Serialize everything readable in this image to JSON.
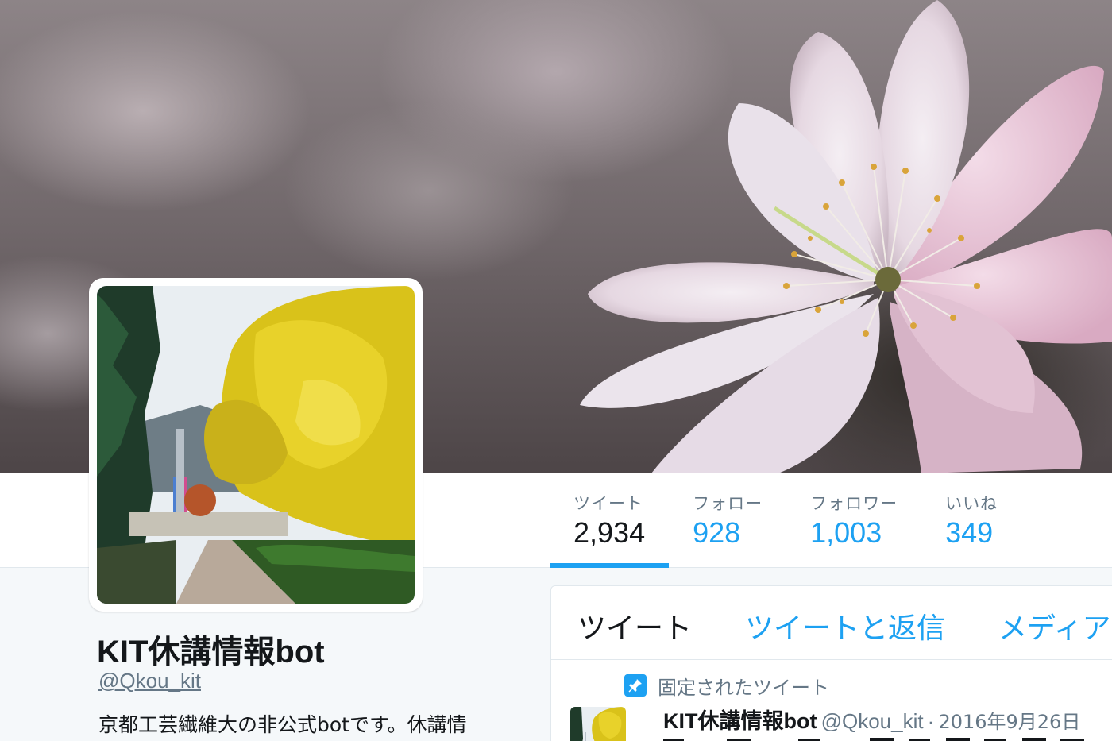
{
  "profile": {
    "name": "KIT休講情報bot",
    "handle": "@Qkou_kit",
    "bio": "京都工芸繊維大の非公式botです。休講情"
  },
  "stats": [
    {
      "label": "ツイート",
      "value": "2,934",
      "active": true
    },
    {
      "label": "フォロー",
      "value": "928",
      "active": false
    },
    {
      "label": "フォロワー",
      "value": "1,003",
      "active": false
    },
    {
      "label": "いいね",
      "value": "349",
      "active": false
    }
  ],
  "timeline": {
    "tabs": [
      "ツイート",
      "ツイートと返信",
      "メディア"
    ],
    "pinned_label": "固定されたツイート",
    "tweet": {
      "name": "KIT休講情報bot",
      "handle": "@Qkou_kit",
      "separator": "·",
      "date": "2016年9月26日"
    }
  },
  "colors": {
    "accent": "#1da1f2",
    "text": "#14171a",
    "muted": "#657786",
    "background": "#f5f8fa"
  },
  "icons": {
    "pin": "pin-icon"
  }
}
